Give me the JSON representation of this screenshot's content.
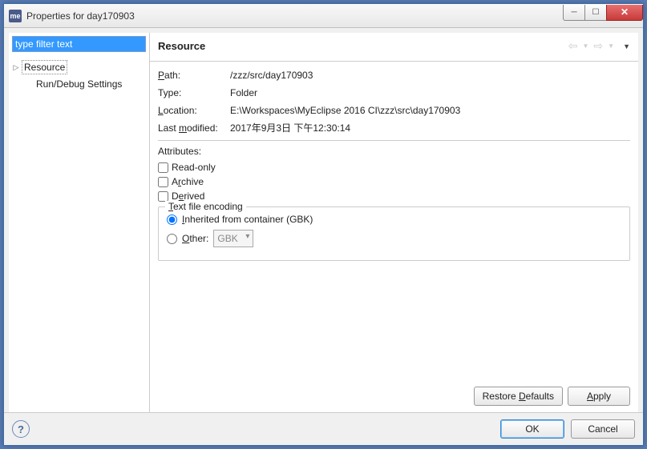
{
  "window": {
    "title": "Properties for day170903",
    "app_icon_text": "me"
  },
  "sidebar": {
    "filter_value": "type filter text",
    "items": [
      {
        "label": "Resource",
        "selected": true,
        "expandable": true,
        "expanded": false
      },
      {
        "label": "Run/Debug Settings",
        "selected": false,
        "expandable": false
      }
    ]
  },
  "content": {
    "title": "Resource",
    "info": {
      "path_k": "Path:",
      "path_v": "/zzz/src/day170903",
      "type_k": "Type:",
      "type_v": "Folder",
      "loc_k": "Location:",
      "loc_v": "E:\\Workspaces\\MyEclipse 2016 CI\\zzz\\src\\day170903",
      "mod_k_pre": "Last ",
      "mod_k_u": "m",
      "mod_k_post": "odified:",
      "mod_v": "2017年9月3日 下午12:30:14"
    },
    "attributes": {
      "title": "Attributes:",
      "readonly": "Read-only",
      "archive": "Archive",
      "derived": "Derived"
    },
    "encoding": {
      "legend_u": "T",
      "legend_post": "ext file encoding",
      "inherited_u": "I",
      "inherited_post": "nherited from container (GBK)",
      "other_u": "O",
      "other_post": "ther:",
      "other_value": "GBK"
    },
    "buttons": {
      "restore_pre": "Restore ",
      "restore_u": "D",
      "restore_post": "efaults",
      "apply": "Apply"
    }
  },
  "footer": {
    "ok": "OK",
    "cancel": "Cancel"
  }
}
